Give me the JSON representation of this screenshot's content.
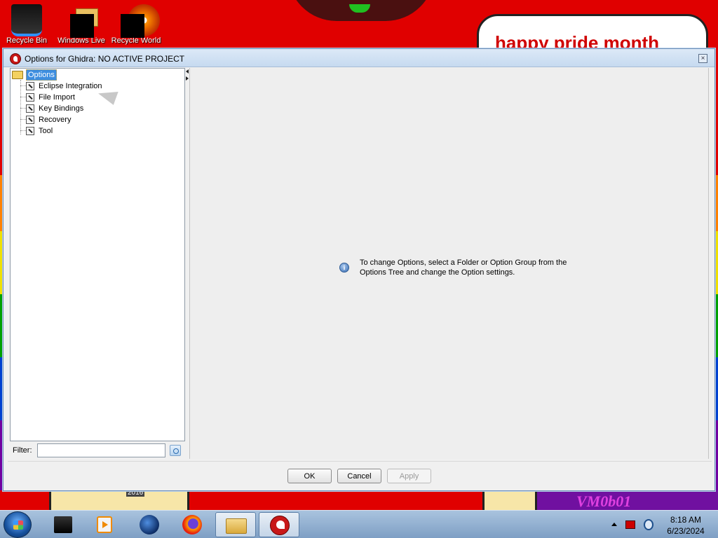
{
  "desktop": {
    "icons": [
      {
        "label": "Recycle Bin"
      },
      {
        "label": "Windows Live"
      },
      {
        "label": "Recycle World"
      }
    ],
    "wallpaper_text": "happy pride month",
    "sticker_text": "2016",
    "watermark": "VM0b01"
  },
  "dialog": {
    "title": "Options for Ghidra: NO ACTIVE PROJECT",
    "close_symbol": "×",
    "tree": {
      "root": {
        "label": "Options",
        "icon": "folder-open-icon",
        "selected": true
      },
      "children": [
        {
          "label": "Eclipse Integration",
          "icon": "wrench-icon"
        },
        {
          "label": "File Import",
          "icon": "wrench-icon"
        },
        {
          "label": "Key Bindings",
          "icon": "wrench-icon"
        },
        {
          "label": "Recovery",
          "icon": "wrench-icon"
        },
        {
          "label": "Tool",
          "icon": "wrench-icon"
        }
      ]
    },
    "filter": {
      "label": "Filter:",
      "value": ""
    },
    "info_message": "To change Options, select a Folder or Option Group from the Options Tree and change the Option settings.",
    "buttons": {
      "ok": "OK",
      "cancel": "Cancel",
      "apply": "Apply",
      "apply_enabled": false
    }
  },
  "taskbar": {
    "items": [
      {
        "icon": "black-app-icon"
      },
      {
        "icon": "media-player-icon"
      },
      {
        "icon": "globe-icon"
      },
      {
        "icon": "firefox-icon"
      },
      {
        "icon": "file-explorer-icon"
      },
      {
        "icon": "ghidra-icon",
        "active": true
      }
    ],
    "clock": {
      "time": "8:18 AM",
      "date": "6/23/2024"
    }
  },
  "colors": {
    "selection": "#3d8ee0",
    "titlebar": "#dce9f7",
    "ghidra_red": "#c81818"
  }
}
